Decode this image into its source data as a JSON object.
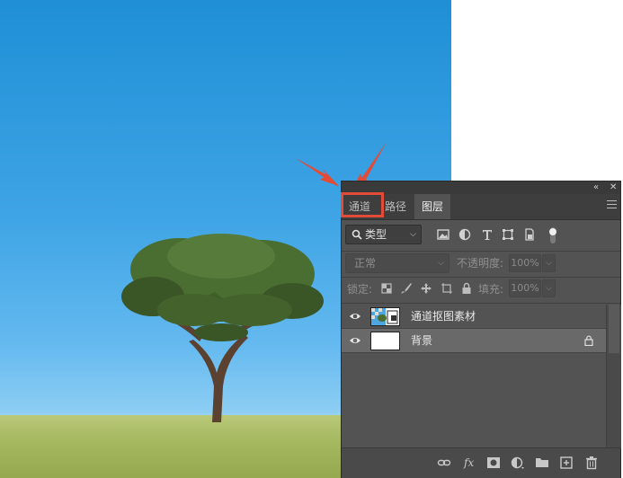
{
  "panel": {
    "collapse_icon": "«",
    "close_icon": "✕",
    "tabs": [
      {
        "label": "通道",
        "active": false
      },
      {
        "label": "路径",
        "active": false
      },
      {
        "label": "图层",
        "active": true
      }
    ],
    "filter": {
      "label": "类型"
    },
    "blend_mode": "正常",
    "opacity_label": "不透明度:",
    "opacity_value": "100%",
    "lock_label": "锁定:",
    "fill_label": "填充:",
    "fill_value": "100%",
    "layers": [
      {
        "name": "通道抠图素材",
        "visible": true,
        "selected": false,
        "locked": false
      },
      {
        "name": "背景",
        "visible": true,
        "selected": true,
        "locked": true
      }
    ]
  },
  "colors": {
    "highlight": "#e24b35",
    "panel_bg": "#535353"
  }
}
